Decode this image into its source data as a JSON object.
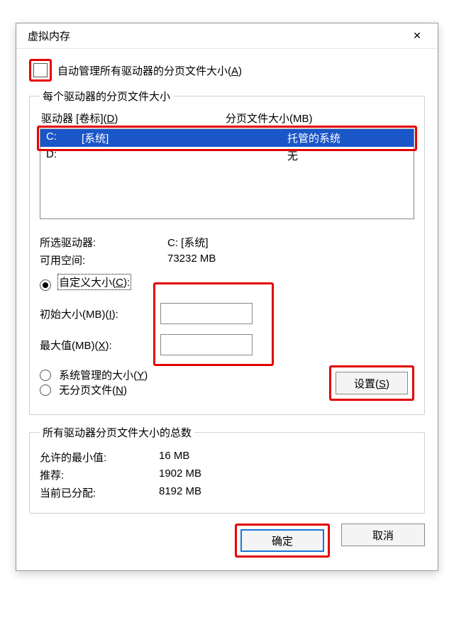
{
  "titlebar": {
    "title": "虚拟内存"
  },
  "auto": {
    "checked": false,
    "label_pre": "自动管理所有驱动器的分页文件大小(",
    "label_u": "A",
    "label_post": ")"
  },
  "perDrive": {
    "legend": "每个驱动器的分页文件大小",
    "header": {
      "drive_pre": "驱动器 [卷标](",
      "drive_u": "D",
      "drive_post": ")",
      "pagefile": "分页文件大小(MB)"
    },
    "rows": [
      {
        "drive": "C:",
        "label": "[系统]",
        "size": "托管的系统",
        "selected": true
      },
      {
        "drive": "D:",
        "label": "",
        "size": "无",
        "selected": false
      }
    ],
    "selected": {
      "drive_label": "所选驱动器:",
      "drive_value": "C:  [系统]",
      "free_label": "可用空间:",
      "free_value": "73232 MB"
    },
    "opts": {
      "custom_pre": "自定义大小(",
      "custom_u": "C",
      "custom_post": "):",
      "initial_pre": "初始大小(MB)(",
      "initial_u": "I",
      "initial_post": "):",
      "initial_value": "",
      "max_pre": "最大值(MB)(",
      "max_u": "X",
      "max_post": "):",
      "max_value": "",
      "system_pre": "系统管理的大小(",
      "system_u": "Y",
      "system_post": ")",
      "none_pre": "无分页文件(",
      "none_u": "N",
      "none_post": ")",
      "set_pre": "设置(",
      "set_u": "S",
      "set_post": ")"
    }
  },
  "totals": {
    "legend": "所有驱动器分页文件大小的总数",
    "min_label": "允许的最小值:",
    "min_value": "16 MB",
    "rec_label": "推荐:",
    "rec_value": "1902 MB",
    "cur_label": "当前已分配:",
    "cur_value": "8192 MB"
  },
  "buttons": {
    "ok": "确定",
    "cancel": "取消"
  }
}
